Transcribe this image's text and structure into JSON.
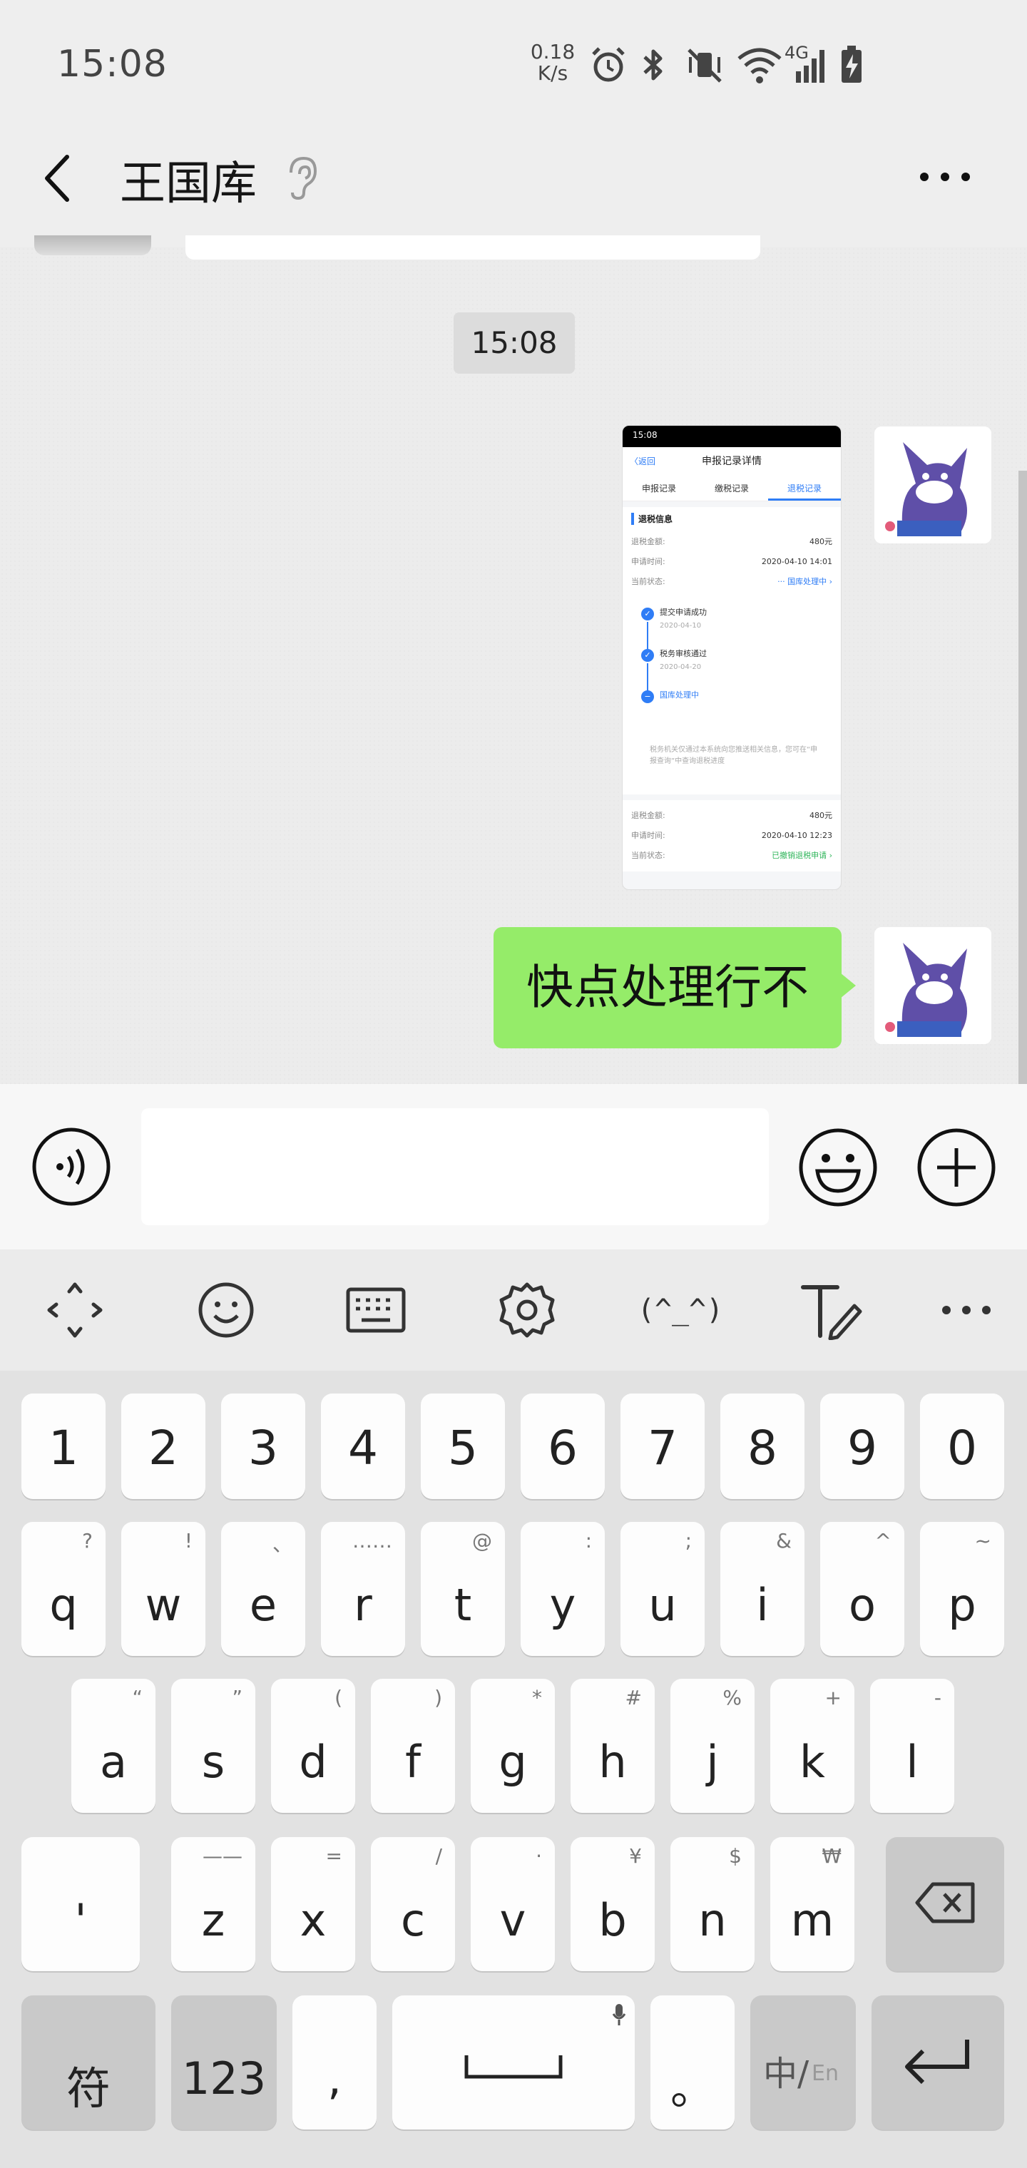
{
  "status_bar": {
    "time": "15:08",
    "net_speed_value": "0.18",
    "net_speed_unit": "K/s",
    "network": "4G",
    "icons": [
      "alarm-icon",
      "bluetooth-icon",
      "mute-vibrate-icon",
      "wifi-icon",
      "signal-icon",
      "battery-charging-icon"
    ]
  },
  "header": {
    "title": "王国库",
    "back_icon": "chevron-left-icon",
    "ear_icon": "ear-icon",
    "more_icon": "more-dots-icon"
  },
  "chat": {
    "timestamp": "15:08",
    "image_message": {
      "status_time": "15:08",
      "nav_back": "〈返回",
      "nav_title": "申报记录详情",
      "tabs": [
        {
          "label": "申报记录",
          "active": false
        },
        {
          "label": "缴税记录",
          "active": false
        },
        {
          "label": "退税记录",
          "active": true
        }
      ],
      "section_title": "退税信息",
      "rows": [
        {
          "label": "退税金额:",
          "value": "480元"
        },
        {
          "label": "申请时间:",
          "value": "2020-04-10 14:01"
        },
        {
          "label": "当前状态:",
          "value": "··· 国库处理中 ›"
        }
      ],
      "steps": [
        {
          "label": "提交申请成功",
          "date": "2020-04-10"
        },
        {
          "label": "税务审核通过",
          "date": "2020-04-20"
        },
        {
          "label": "国库处理中",
          "date": ""
        }
      ],
      "note": "税务机关仅通过本系统向您推送相关信息，您可在“申报查询”中查询退税进度",
      "rows2": [
        {
          "label": "退税金额:",
          "value": "480元"
        },
        {
          "label": "申请时间:",
          "value": "2020-04-10 12:23"
        },
        {
          "label": "当前状态:",
          "value": "已撤销退税申请 ›"
        }
      ]
    },
    "text_message": "快点处理行不"
  },
  "input_bar": {
    "voice_icon": "voice-icon",
    "input_value": "",
    "emoji_icon": "emoji-icon",
    "plus_icon": "plus-icon"
  },
  "keyboard_toolbar": {
    "items": [
      "move-cursor-icon",
      "emoji-icon",
      "keyboard-icon",
      "settings-gear-icon",
      "kaomoji",
      "handwriting-icon",
      "more-dots-icon"
    ],
    "kaomoji_label": "(^_^)"
  },
  "keyboard": {
    "numbers": [
      "1",
      "2",
      "3",
      "4",
      "5",
      "6",
      "7",
      "8",
      "9",
      "0"
    ],
    "row1": [
      {
        "main": "q",
        "hint": "?"
      },
      {
        "main": "w",
        "hint": "!"
      },
      {
        "main": "e",
        "hint": "、"
      },
      {
        "main": "r",
        "hint": "……"
      },
      {
        "main": "t",
        "hint": "@"
      },
      {
        "main": "y",
        "hint": ":"
      },
      {
        "main": "u",
        "hint": ";"
      },
      {
        "main": "i",
        "hint": "&"
      },
      {
        "main": "o",
        "hint": "^"
      },
      {
        "main": "p",
        "hint": "~"
      }
    ],
    "row2": [
      {
        "main": "a",
        "hint": "“"
      },
      {
        "main": "s",
        "hint": "”"
      },
      {
        "main": "d",
        "hint": "("
      },
      {
        "main": "f",
        "hint": ")"
      },
      {
        "main": "g",
        "hint": "*"
      },
      {
        "main": "h",
        "hint": "#"
      },
      {
        "main": "j",
        "hint": "%"
      },
      {
        "main": "k",
        "hint": "+"
      },
      {
        "main": "l",
        "hint": "-"
      }
    ],
    "row3": [
      {
        "main": "z",
        "hint": "——"
      },
      {
        "main": "x",
        "hint": "="
      },
      {
        "main": "c",
        "hint": "/"
      },
      {
        "main": "v",
        "hint": "·"
      },
      {
        "main": "b",
        "hint": "¥"
      },
      {
        "main": "n",
        "hint": "$"
      },
      {
        "main": "m",
        "hint": "₩"
      }
    ],
    "apostrophe": "'",
    "symbol_key": "符",
    "num_key": "123",
    "comma_key": ",",
    "period_key": "。",
    "lang_key_main": "中/",
    "lang_key_sub": "En",
    "backspace_icon": "backspace-icon",
    "space_icon": "space-bar-icon",
    "mic_icon": "mic-icon",
    "enter_icon": "enter-icon"
  }
}
